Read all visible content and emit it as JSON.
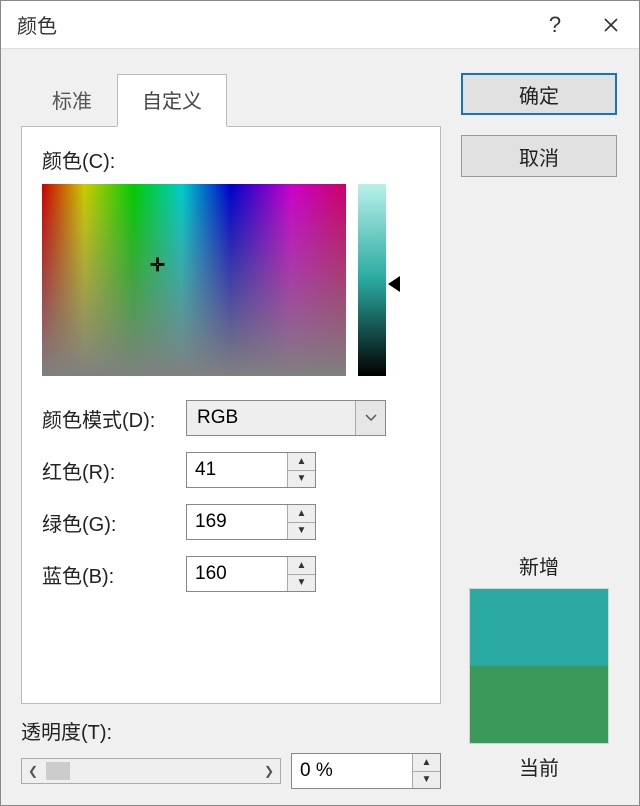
{
  "title": "颜色",
  "tabs": {
    "standard": "标准",
    "custom": "自定义"
  },
  "buttons": {
    "ok": "确定",
    "cancel": "取消"
  },
  "labels": {
    "colors": "颜色(C):",
    "model": "颜色模式(D):",
    "red": "红色(R):",
    "green": "绿色(G):",
    "blue": "蓝色(B):",
    "transparency": "透明度(T):",
    "new": "新增",
    "current": "当前"
  },
  "model": {
    "selected": "RGB"
  },
  "rgb": {
    "r": "41",
    "g": "169",
    "b": "160"
  },
  "transparency": {
    "value": "0 %"
  },
  "preview": {
    "new_color": "#29a9a0",
    "current_color": "#3a9a5a"
  }
}
